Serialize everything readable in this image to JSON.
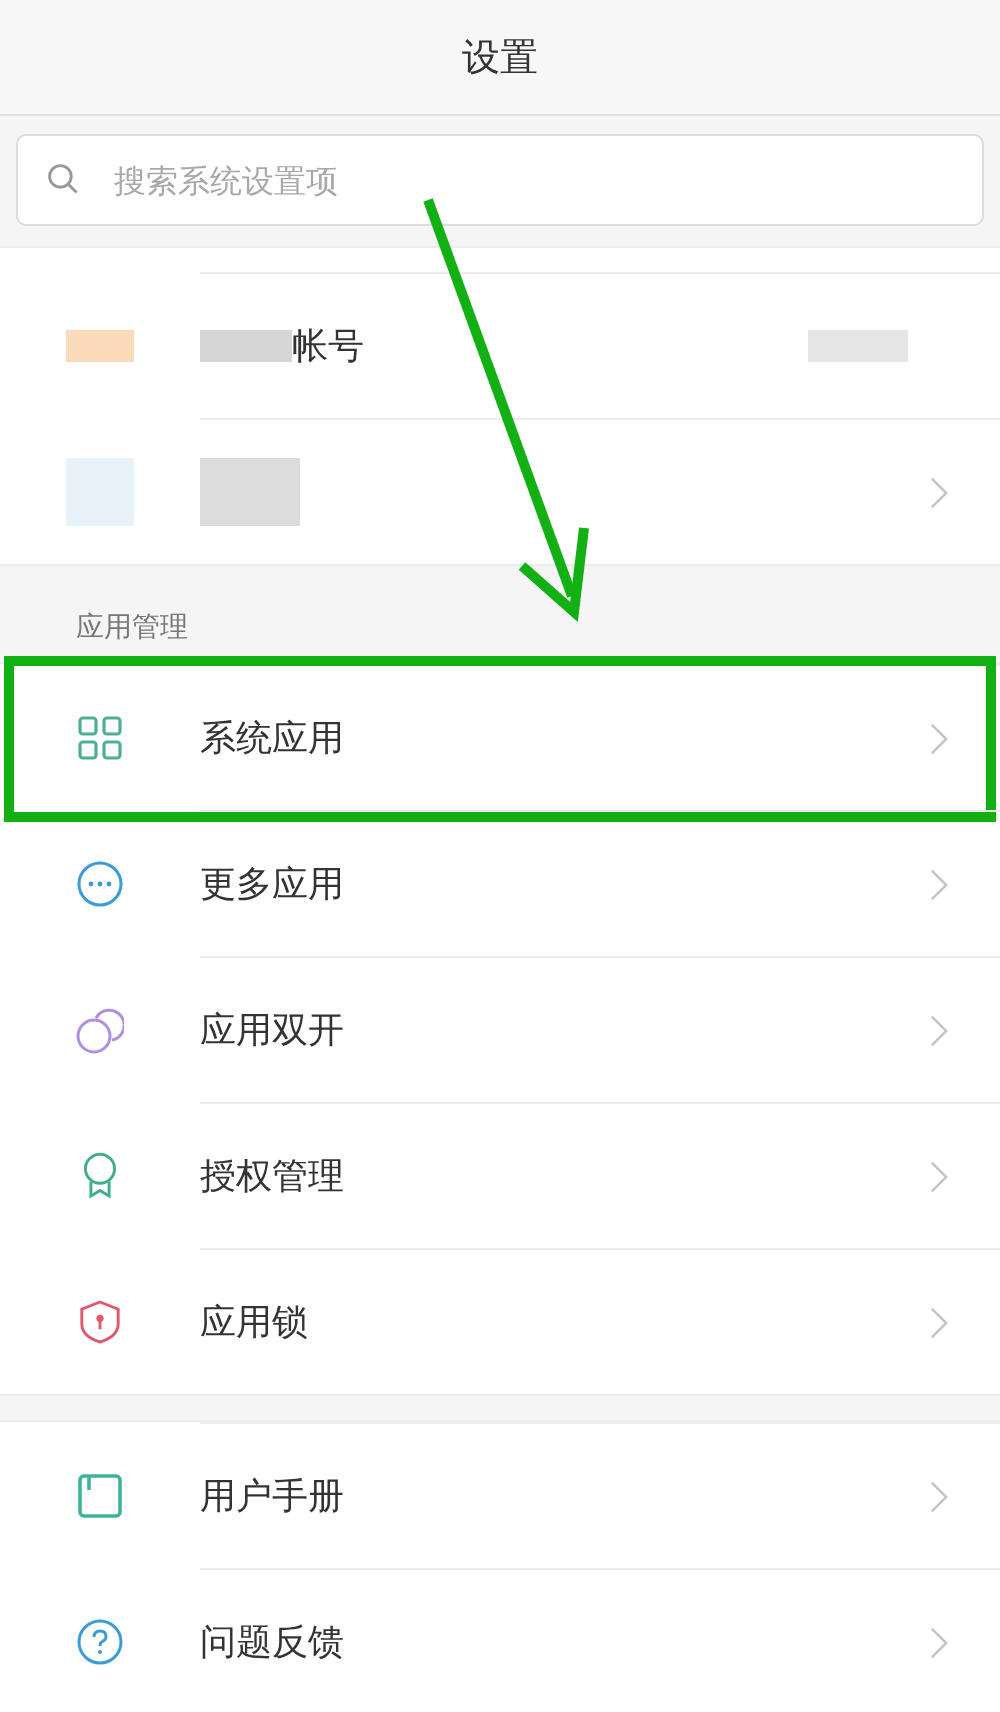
{
  "header": {
    "title": "设置"
  },
  "search": {
    "placeholder": "搜索系统设置项"
  },
  "account_rows": [
    {
      "kind": "named",
      "label": "帐号"
    },
    {
      "kind": "blurred"
    }
  ],
  "sections": [
    {
      "title": "应用管理",
      "items": [
        {
          "label": "系统应用",
          "highlighted": true
        },
        {
          "label": "更多应用",
          "highlighted": false
        },
        {
          "label": "应用双开",
          "highlighted": false
        },
        {
          "label": "授权管理",
          "highlighted": false
        },
        {
          "label": "应用锁",
          "highlighted": false
        }
      ]
    },
    {
      "items": [
        {
          "label": "用户手册",
          "highlighted": false
        },
        {
          "label": "问题反馈",
          "highlighted": false
        }
      ]
    }
  ]
}
